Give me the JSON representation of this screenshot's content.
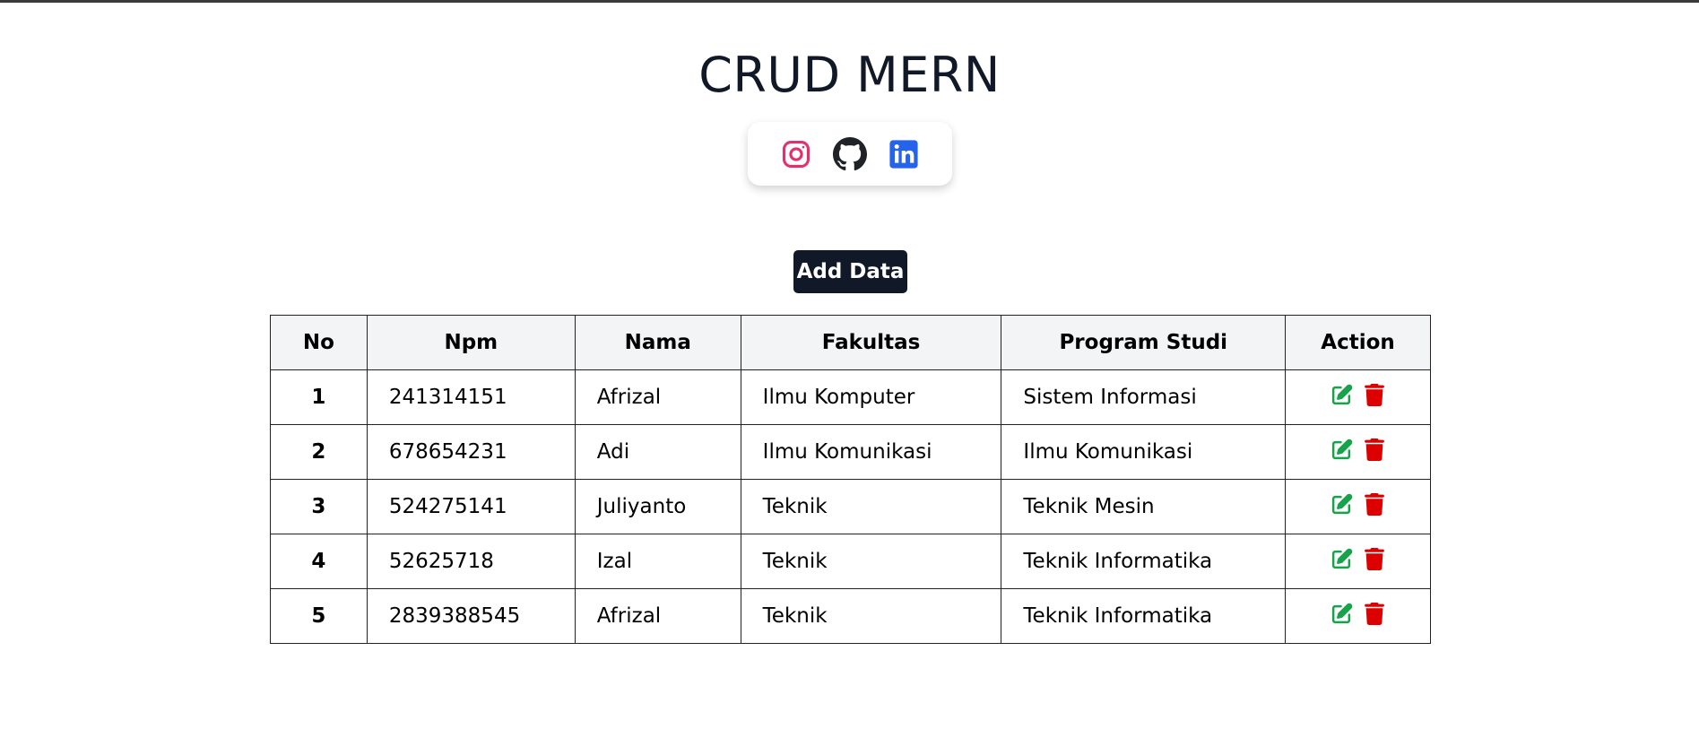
{
  "page": {
    "title": "CRUD MERN"
  },
  "social": {
    "items": [
      {
        "name": "instagram-icon",
        "color": "#e1306c"
      },
      {
        "name": "github-icon",
        "color": "#1f2328"
      },
      {
        "name": "linkedin-icon",
        "color": "#2563eb"
      }
    ]
  },
  "toolbar": {
    "add_label": "Add Data"
  },
  "table": {
    "headers": [
      "No",
      "Npm",
      "Nama",
      "Fakultas",
      "Program Studi",
      "Action"
    ],
    "rows": [
      {
        "no": "1",
        "npm": "241314151",
        "nama": "Afrizal",
        "fakultas": "Ilmu Komputer",
        "prodi": "Sistem Informasi"
      },
      {
        "no": "2",
        "npm": "678654231",
        "nama": "Adi",
        "fakultas": "Ilmu Komunikasi",
        "prodi": "Ilmu Komunikasi"
      },
      {
        "no": "3",
        "npm": "524275141",
        "nama": "Juliyanto",
        "fakultas": "Teknik",
        "prodi": "Teknik Mesin"
      },
      {
        "no": "4",
        "npm": "52625718",
        "nama": "Izal",
        "fakultas": "Teknik",
        "prodi": "Teknik Informatika"
      },
      {
        "no": "5",
        "npm": "2839388545",
        "nama": "Afrizal",
        "fakultas": "Teknik",
        "prodi": "Teknik Informatika"
      }
    ],
    "actions": {
      "edit_icon": "edit-icon",
      "delete_icon": "trash-icon",
      "edit_color": "#16a34a",
      "delete_color": "#dc0000"
    }
  }
}
